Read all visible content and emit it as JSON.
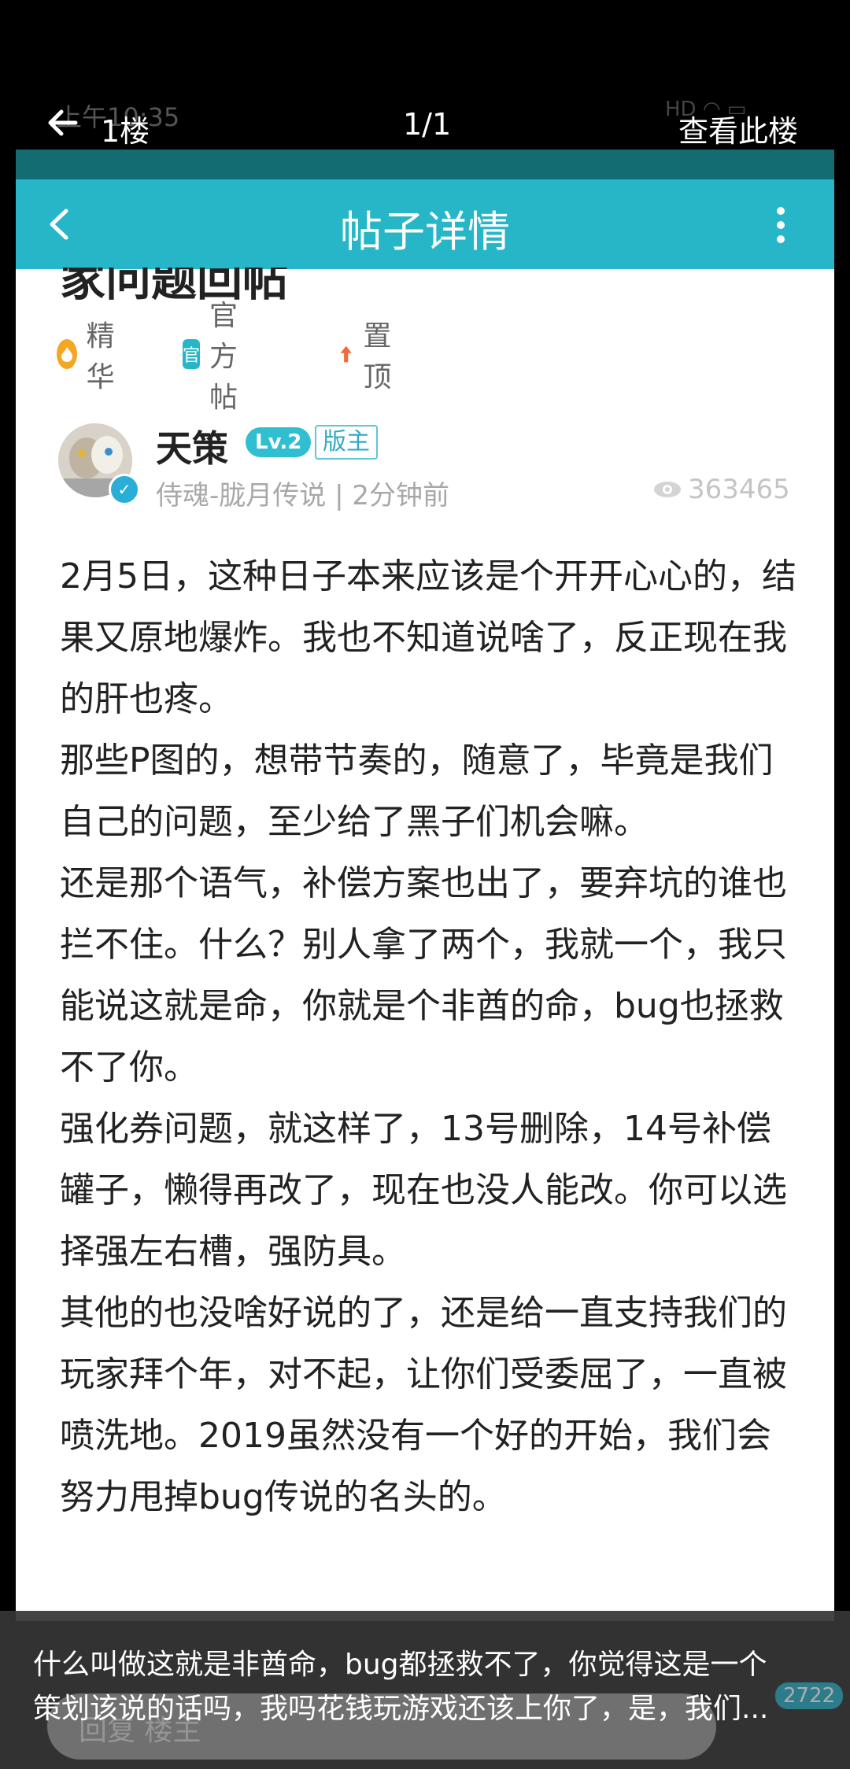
{
  "status_bar": {
    "time": "上午10:35"
  },
  "viewer": {
    "floor_label": "1楼",
    "page_indicator": "1/1",
    "view_floor_label": "查看此楼"
  },
  "app": {
    "title": "帖子详情",
    "accent_color": "#26b6c7"
  },
  "post": {
    "title_fragment": "家问题回帖",
    "tags": [
      {
        "icon": "flame-icon",
        "label": "精华",
        "color": "#f5a623"
      },
      {
        "icon": "official-icon",
        "label": "官方帖",
        "icon_text": "官",
        "color": "#26b6c7"
      },
      {
        "icon": "arrow-up-icon",
        "label": "置顶",
        "color": "#f06a3a"
      }
    ],
    "author": {
      "name": "天策",
      "level": "Lv.2",
      "role": "版主",
      "forum": "侍魂-胧月传说",
      "time": "2分钟前",
      "views": "363465"
    },
    "paragraphs": [
      "2月5日，这种日子本来应该是个开开心心的，结果又原地爆炸。我也不知道说啥了，反正现在我的肝也疼。",
      "那些P图的，想带节奏的，随意了，毕竟是我们自己的问题，至少给了黑子们机会嘛。",
      "还是那个语气，补偿方案也出了，要弃坑的谁也拦不住。什么？别人拿了两个，我就一个，我只能说这就是命，你就是个非酋的命，bug也拯救不了你。",
      "强化券问题，就这样了，13号删除，14号补偿罐子，懒得再改了，现在也没人能改。你可以选择强左右槽，强防具。",
      "其他的也没啥好说的了，还是给一直支持我们的玩家拜个年，对不起，让你们受委屈了，一直被喷洗地。2019虽然没有一个好的开始，我们会努力甩掉bug传说的名头的。"
    ]
  },
  "comment_bar": {
    "placeholder": "回复 楼主",
    "count": "2722"
  },
  "caption": {
    "line1": "什么叫做这就是非酋命，bug都拯救不了，你觉得这是一个",
    "line2": "策划该说的话吗，我吗花钱玩游戏还该上你了，是，我们..."
  }
}
